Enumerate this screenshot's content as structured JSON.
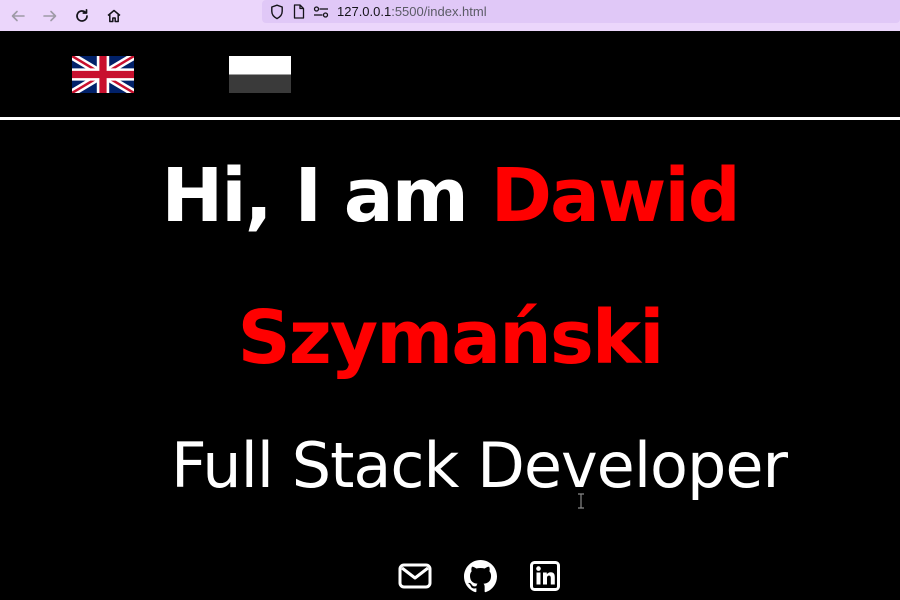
{
  "browser": {
    "url_host": "127.0.0.1",
    "url_path": ":5500/index.html",
    "back_icon": "arrow-left-icon",
    "forward_icon": "arrow-right-icon",
    "reload_icon": "reload-icon",
    "home_icon": "home-icon"
  },
  "languages": [
    {
      "name": "uk-flag-icon"
    },
    {
      "name": "poland-flag-icon"
    }
  ],
  "hero": {
    "greeting": "Hi, I am ",
    "first_name": "Dawid",
    "last_name": "Szymański",
    "role": "Full Stack Developer"
  },
  "socials": [
    {
      "icon": "mail-icon"
    },
    {
      "icon": "github-icon"
    },
    {
      "icon": "linkedin-icon"
    }
  ],
  "colors": {
    "accent": "#ff0000",
    "background": "#000000",
    "text": "#ffffff",
    "browser_chrome": "#ebd6fb"
  }
}
